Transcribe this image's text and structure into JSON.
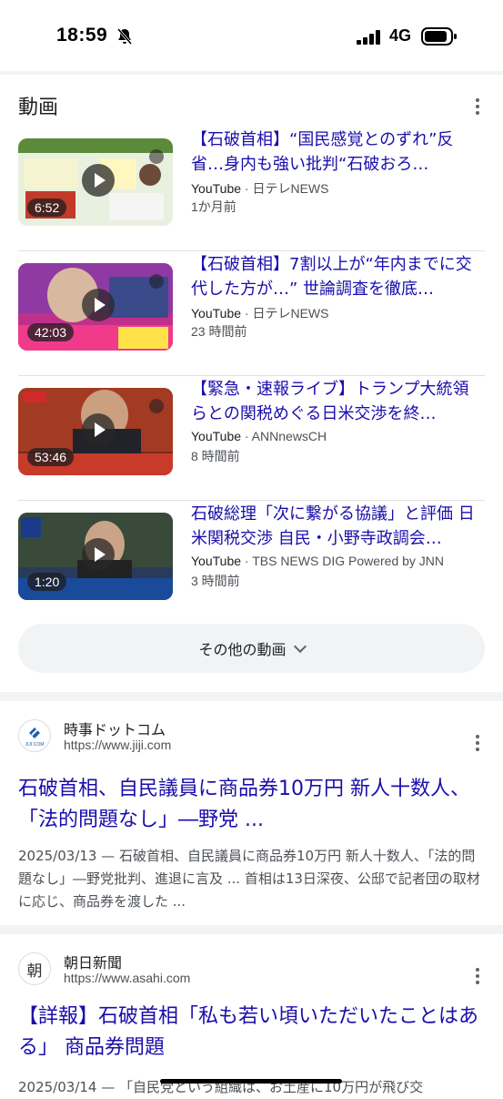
{
  "status_bar": {
    "time": "18:59",
    "network": "4G"
  },
  "videos": {
    "header": "動画",
    "items": [
      {
        "title": "【石破首相】“国民感覚とのずれ”反省…身内も強い批判“石破おろ…",
        "platform": "YouTube",
        "channel": " · 日テレNEWS",
        "age": "1か月前",
        "duration": "6:52"
      },
      {
        "title": "【石破首相】7割以上が“年内までに交代した方が…” 世論調査を徹底…",
        "platform": "YouTube",
        "channel": " · 日テレNEWS",
        "age": "23 時間前",
        "duration": "42:03"
      },
      {
        "title": "【緊急・速報ライブ】トランプ大統領らとの関税めぐる日米交渉を終…",
        "platform": "YouTube",
        "channel": " · ANNnewsCH",
        "age": "8 時間前",
        "duration": "53:46"
      },
      {
        "title": "石破総理「次に繋がる協議」と評価 日米関税交渉 自民・小野寺政調会…",
        "platform": "YouTube",
        "channel": " · TBS NEWS DIG Powered by JNN",
        "age": "3 時間前",
        "duration": "1:20"
      }
    ],
    "more_label": "その他の動画"
  },
  "results": [
    {
      "site_name": "時事ドットコム",
      "url": "https://www.jiji.com",
      "favicon_text": "JIJI.COM",
      "title": "石破首相、自民議員に商品券10万円 新人十数人、「法的問題なし」―野党 ...",
      "snippet": "2025/03/13 — 石破首相、自民議員に商品券10万円 新人十数人、「法的問題なし」―野党批判、進退に言及 ... 首相は13日深夜、公邸で記者団の取材に応じ、商品券を渡した ..."
    },
    {
      "site_name": "朝日新聞",
      "url": "https://www.asahi.com",
      "favicon_text": "朝",
      "title": "【詳報】石破首相「私も若い頃いただいたことはある」 商品券問題",
      "snippet": "2025/03/14 — 「自民党という組織は、お土産に10万円が飛び交"
    }
  ],
  "colors": {
    "link": "#1a0dab",
    "text": "#202124",
    "muted": "#4d5156",
    "divider": "#f1f3f4"
  }
}
